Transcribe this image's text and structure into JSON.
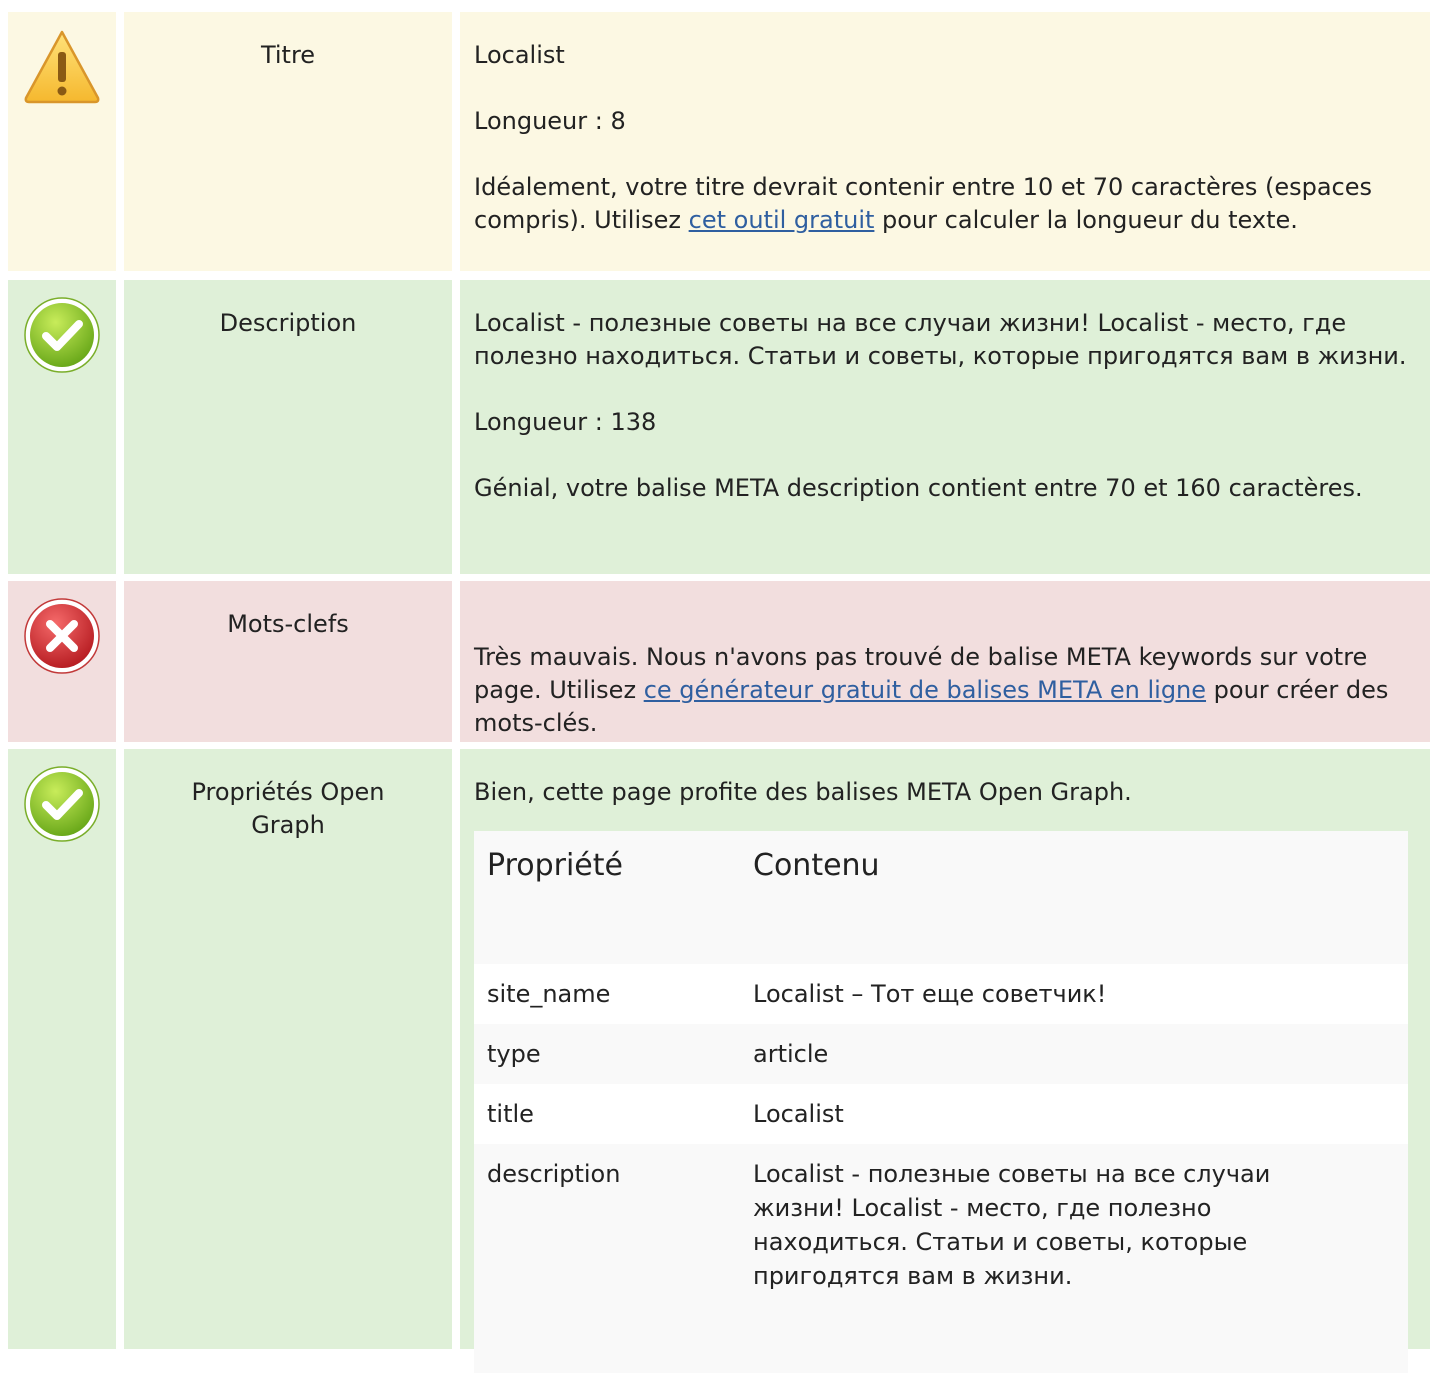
{
  "rows": {
    "title": {
      "label": "Titre",
      "value": "Localist",
      "length": "Longueur : 8",
      "note_before": "Idéalement, votre titre devrait contenir entre 10 et 70 caractères (espaces compris). Utilisez ",
      "link": "cet outil gratuit",
      "note_after": " pour calculer la longueur du texte."
    },
    "description": {
      "label": "Description",
      "value": "Localist - полезные советы на все случаи жизни! Localist - место, где полезно находиться. Статьи и советы, которые пригодятся вам в жизни.",
      "length": "Longueur : 138",
      "note": "Génial, votre balise META description contient entre 70 et 160 caractères."
    },
    "keywords": {
      "label": "Mots-clefs",
      "note_before": "Très mauvais. Nous n'avons pas trouvé de balise META keywords sur votre page. Utilisez ",
      "link": "ce générateur gratuit de balises META en ligne",
      "note_after": " pour créer des mots-clés."
    },
    "opengraph": {
      "label": "Propriétés Open Graph",
      "note": "Bien, cette page profite des balises META Open Graph.",
      "table": {
        "headers": [
          "Propriété",
          "Contenu"
        ],
        "rows": [
          {
            "property": "site_name",
            "content": "Localist – Тот еще советчик!"
          },
          {
            "property": "type",
            "content": "article"
          },
          {
            "property": "title",
            "content": "Localist"
          },
          {
            "property": "description",
            "content": "Localist - полезные советы на все случаи жизни! Localist - место, где полезно находиться. Статьи и советы, которые пригодятся вам в жизни."
          }
        ]
      }
    }
  },
  "status_icons": {
    "title": "warning-icon",
    "description": "check-icon",
    "keywords": "error-icon",
    "opengraph": "check-icon"
  },
  "colors": {
    "warning_bg": "#fcf8e3",
    "success_bg": "#dff0d8",
    "error_bg": "#f2dede",
    "link": "#2f5fa0"
  }
}
